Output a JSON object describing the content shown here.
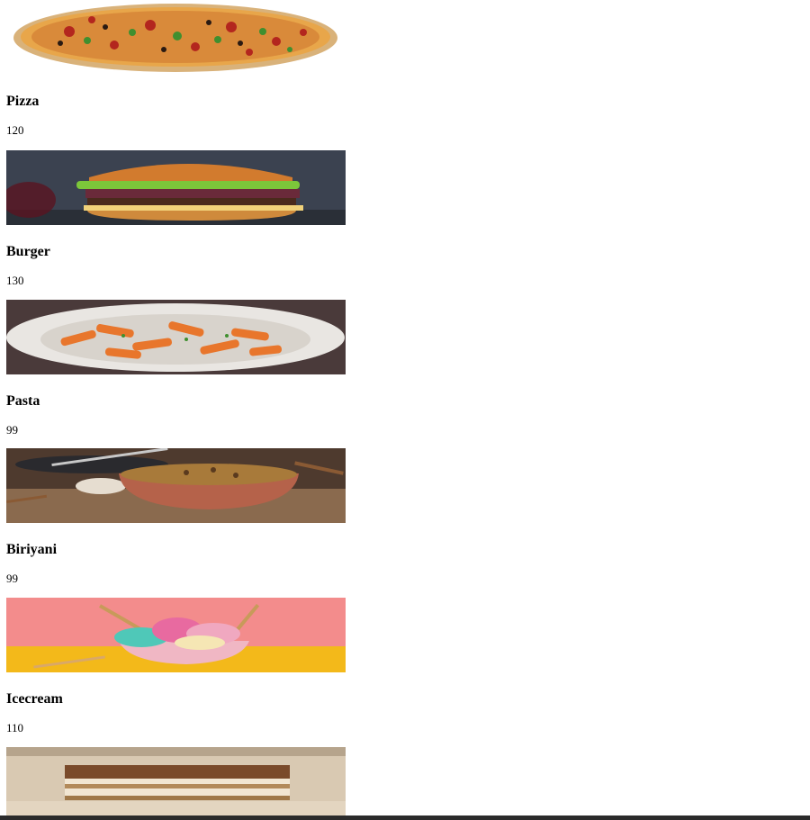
{
  "menu": {
    "items": [
      {
        "name": "Pizza",
        "price": "120",
        "image_icon": "pizza-image"
      },
      {
        "name": "Burger",
        "price": "130",
        "image_icon": "burger-image"
      },
      {
        "name": "Pasta",
        "price": "99",
        "image_icon": "pasta-image"
      },
      {
        "name": "Biriyani",
        "price": "99",
        "image_icon": "biriyani-image"
      },
      {
        "name": "Icecream",
        "price": "110",
        "image_icon": "icecream-image"
      },
      {
        "name": "",
        "price": "",
        "image_icon": "tiramisu-image"
      }
    ]
  }
}
